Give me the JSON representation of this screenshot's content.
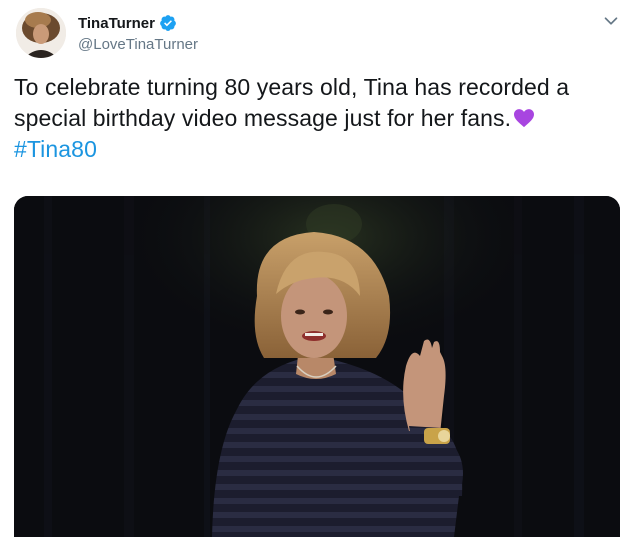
{
  "author": {
    "display_name": "TinaTurner",
    "handle": "@LoveTinaTurner",
    "verified": true
  },
  "tweet": {
    "line1": "To celebrate turning 80 years old, Tina has recorded a",
    "line2": "special birthday video message just for her fans.",
    "emoji": "purple-heart",
    "hashtag": "#Tina80"
  },
  "icons": {
    "verified": "verified-badge-icon",
    "menu": "chevron-down-icon"
  },
  "colors": {
    "hashtag": "#1b95e0",
    "verified": "#1da1f2",
    "heart": "#a845e0",
    "text": "#14171a",
    "secondary": "#657786"
  }
}
